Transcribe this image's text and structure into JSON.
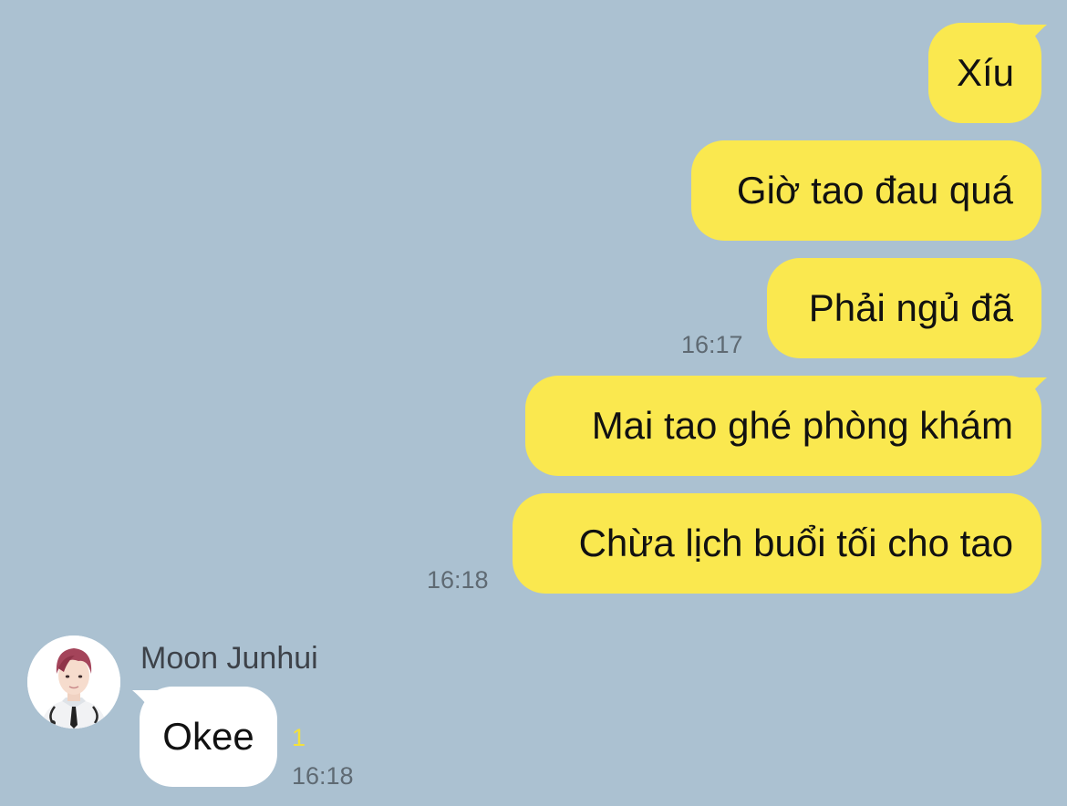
{
  "chat": {
    "outgoing": [
      {
        "text": "Xíu"
      },
      {
        "text": "Giờ tao đau quá"
      },
      {
        "text": "Phải ngủ đã",
        "time": "16:17"
      },
      {
        "text": "Mai tao ghé phòng khám"
      },
      {
        "text": "Chừa lịch buổi tối cho tao",
        "time": "16:18"
      }
    ],
    "incoming": {
      "sender": "Moon Junhui",
      "avatar_icon": "person-avatar",
      "text": "Okee",
      "unread": "1",
      "time": "16:18"
    }
  },
  "colors": {
    "background": "#abc1d1",
    "outgoing_bubble": "#fae84f",
    "incoming_bubble": "#ffffff",
    "unread_count": "#f4e13a",
    "timestamp": "#5f6a73"
  }
}
